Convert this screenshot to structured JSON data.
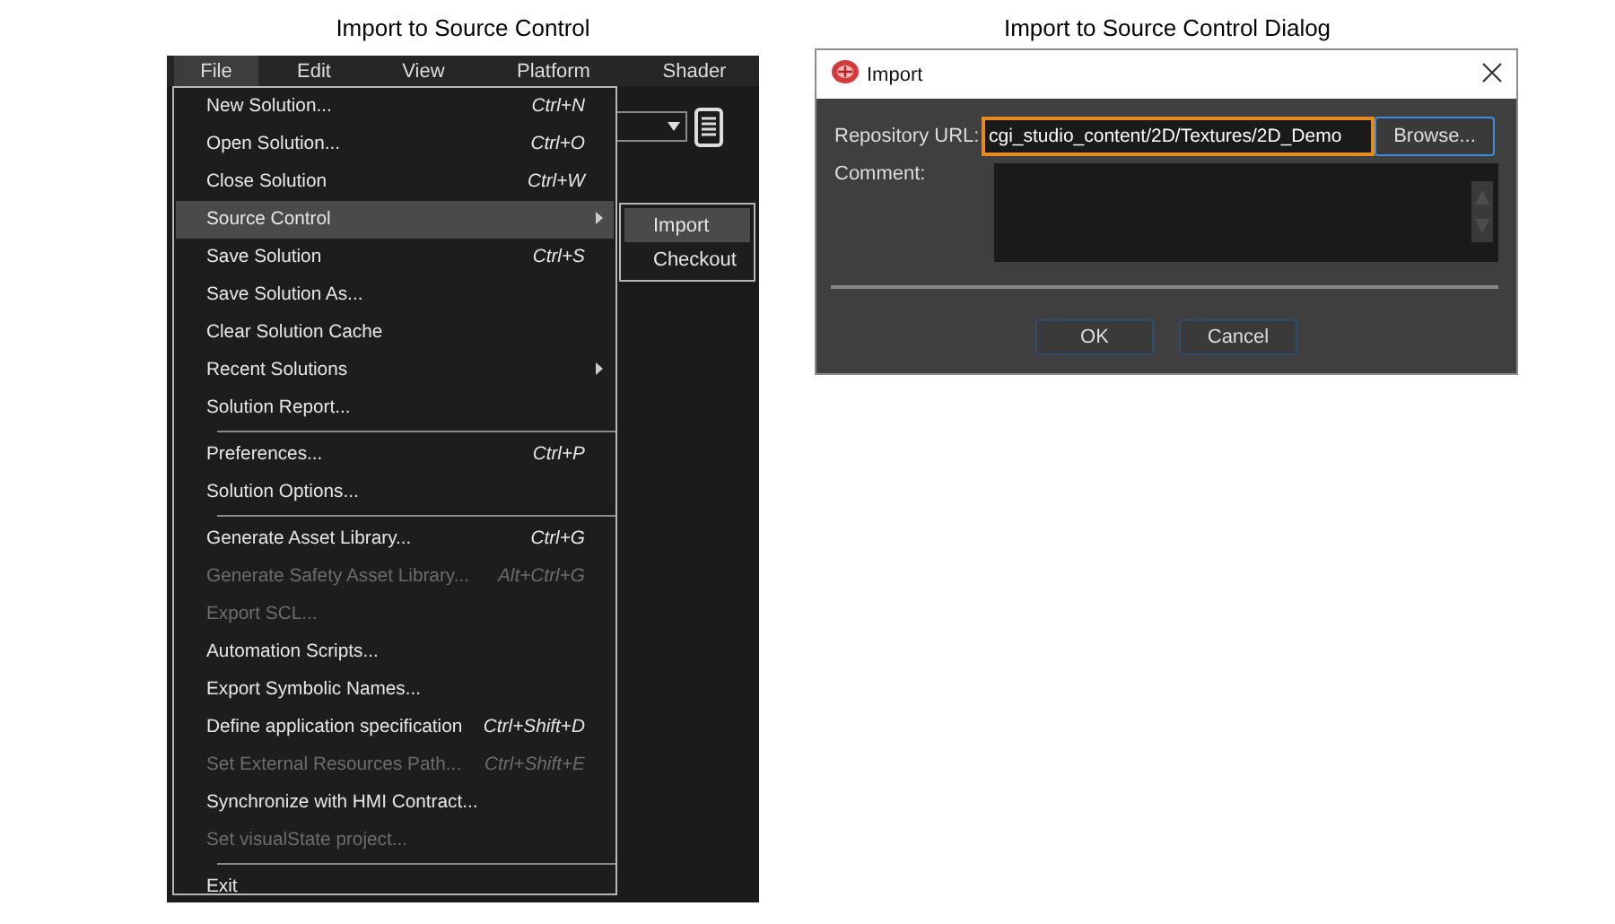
{
  "left": {
    "caption": "Import to Source Control",
    "menu_bar": [
      {
        "label": "File",
        "selected": true
      },
      {
        "label": "Edit",
        "selected": false
      },
      {
        "label": "View",
        "selected": false
      },
      {
        "label": "Platform",
        "selected": false
      },
      {
        "label": "Shader",
        "selected": false
      }
    ],
    "file_menu": [
      {
        "kind": "item",
        "label": "New Solution...",
        "shortcut": "Ctrl+N",
        "disabled": false,
        "selected": false,
        "submenu": false
      },
      {
        "kind": "item",
        "label": "Open Solution...",
        "shortcut": "Ctrl+O",
        "disabled": false,
        "selected": false,
        "submenu": false
      },
      {
        "kind": "item",
        "label": "Close Solution",
        "shortcut": "Ctrl+W",
        "disabled": false,
        "selected": false,
        "submenu": false
      },
      {
        "kind": "item",
        "label": "Source Control",
        "disabled": false,
        "selected": true,
        "submenu": true
      },
      {
        "kind": "item",
        "label": "Save Solution",
        "shortcut": "Ctrl+S",
        "disabled": false,
        "selected": false,
        "submenu": false
      },
      {
        "kind": "item",
        "label": "Save Solution As...",
        "disabled": false,
        "selected": false,
        "submenu": false
      },
      {
        "kind": "item",
        "label": "Clear Solution Cache",
        "disabled": false,
        "selected": false,
        "submenu": false
      },
      {
        "kind": "item",
        "label": "Recent Solutions",
        "disabled": false,
        "selected": false,
        "submenu": true
      },
      {
        "kind": "item",
        "label": "Solution Report...",
        "disabled": false,
        "selected": false,
        "submenu": false
      },
      {
        "kind": "separator"
      },
      {
        "kind": "item",
        "label": "Preferences...",
        "shortcut": "Ctrl+P",
        "disabled": false,
        "selected": false,
        "submenu": false
      },
      {
        "kind": "item",
        "label": "Solution Options...",
        "disabled": false,
        "selected": false,
        "submenu": false
      },
      {
        "kind": "separator"
      },
      {
        "kind": "item",
        "label": "Generate Asset Library...",
        "shortcut": "Ctrl+G",
        "disabled": false,
        "selected": false,
        "submenu": false
      },
      {
        "kind": "item",
        "label": "Generate Safety Asset Library...",
        "shortcut": "Alt+Ctrl+G",
        "disabled": true,
        "selected": false,
        "submenu": false
      },
      {
        "kind": "item",
        "label": "Export SCL...",
        "disabled": true,
        "selected": false,
        "submenu": false
      },
      {
        "kind": "item",
        "label": "Automation Scripts...",
        "disabled": false,
        "selected": false,
        "submenu": false
      },
      {
        "kind": "item",
        "label": "Export Symbolic Names...",
        "disabled": false,
        "selected": false,
        "submenu": false
      },
      {
        "kind": "item",
        "label": "Define application specification",
        "shortcut": "Ctrl+Shift+D",
        "disabled": false,
        "selected": false,
        "submenu": false
      },
      {
        "kind": "item",
        "label": "Set External Resources Path...",
        "shortcut": "Ctrl+Shift+E",
        "disabled": true,
        "selected": false,
        "submenu": false
      },
      {
        "kind": "item",
        "label": "Synchronize with HMI Contract...",
        "disabled": false,
        "selected": false,
        "submenu": false
      },
      {
        "kind": "item",
        "label": "Set visualState project...",
        "disabled": true,
        "selected": false,
        "submenu": false
      },
      {
        "kind": "separator"
      },
      {
        "kind": "item",
        "label": "Exit",
        "disabled": false,
        "selected": false,
        "submenu": false
      }
    ],
    "submenu": [
      {
        "label": "Import",
        "selected": true
      },
      {
        "label": "Checkout",
        "selected": false
      }
    ]
  },
  "right": {
    "caption": "Import to Source Control Dialog",
    "dialog": {
      "title": "Import",
      "url_label": "Repository URL:",
      "url_value": "cgi_studio_content/2D/Textures/2D_Demo",
      "url_focused": true,
      "browse": {
        "label": "Browse...",
        "highlighted": true
      },
      "comment_label": "Comment:",
      "buttons": [
        {
          "label": "OK",
          "highlighted": false
        },
        {
          "label": "Cancel",
          "highlighted": false
        }
      ]
    }
  }
}
